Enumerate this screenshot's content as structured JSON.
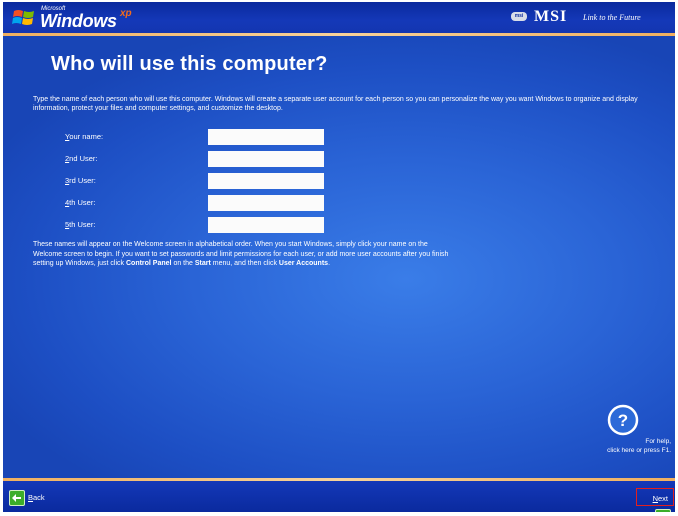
{
  "header": {
    "microsoft_label": "Microsoft",
    "windows_label": "Windows",
    "xp_label": "xp",
    "oem_badge": "msi",
    "oem_name": "MSI",
    "oem_tagline": "Link to the Future"
  },
  "page": {
    "title": "Who will use this computer?",
    "intro": "Type the name of each person who will use this computer. Windows will create a separate user account for each person so you can personalize the way you want Windows to organize and display information, protect your files and computer settings, and customize the desktop."
  },
  "fields": [
    {
      "label_u": "Y",
      "label_rest": "our name:",
      "value": ""
    },
    {
      "label_u": "2",
      "label_rest": "nd User:",
      "value": ""
    },
    {
      "label_u": "3",
      "label_rest": "rd User:",
      "value": ""
    },
    {
      "label_u": "4",
      "label_rest": "th User:",
      "value": ""
    },
    {
      "label_u": "5",
      "label_rest": "th User:",
      "value": ""
    }
  ],
  "notes": {
    "part1": "These names will appear on the Welcome screen in alphabetical order. When you start Windows, simply click your name on the Welcome screen to begin. If you want to set passwords and limit permissions for each user, or add more user accounts after you finish setting up Windows, just click ",
    "control_panel": "Control Panel",
    "part2": " on the ",
    "start": "Start",
    "part3": " menu, and then click ",
    "user_accounts": "User Accounts",
    "part4": "."
  },
  "help": {
    "line1": "For help,",
    "line2": "click here or press F1."
  },
  "nav": {
    "back_u": "B",
    "back_rest": "ack",
    "next_u": "N",
    "next_rest": "ext"
  },
  "colors": {
    "background": "#2a64d6",
    "bar": "#0a2a9e",
    "accent_line": "#f0b060",
    "arrow_green": "#3cae2a",
    "highlight": "#e02020"
  }
}
